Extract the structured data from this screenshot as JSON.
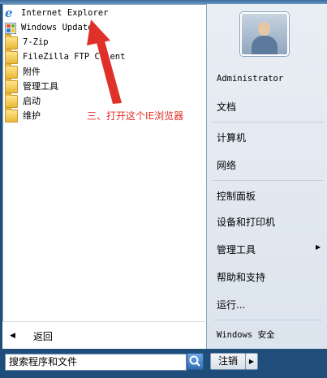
{
  "programs": [
    {
      "label": "Internet Explorer",
      "icon": "internet-explorer-icon",
      "mono": true
    },
    {
      "label": "Windows Update",
      "icon": "windows-update-icon",
      "mono": true
    },
    {
      "label": "7-Zip",
      "icon": "folder-icon",
      "mono": true
    },
    {
      "label": "FileZilla FTP Client",
      "icon": "folder-icon",
      "mono": true
    },
    {
      "label": "附件",
      "icon": "folder-icon",
      "mono": false
    },
    {
      "label": "管理工具",
      "icon": "folder-icon",
      "mono": false
    },
    {
      "label": "启动",
      "icon": "folder-icon",
      "mono": false
    },
    {
      "label": "维护",
      "icon": "folder-icon",
      "mono": false
    }
  ],
  "back_label": "返回",
  "annotation": "三、打开这个IE浏览器",
  "search": {
    "value": "搜索程序和文件"
  },
  "shutdown_label": "注销",
  "right_items": {
    "user": "Administrator",
    "documents": "文档",
    "computer": "计算机",
    "network": "网络",
    "control_panel": "控制面板",
    "devices_printers": "设备和打印机",
    "admin_tools": "管理工具",
    "help": "帮助和支持",
    "run": "运行...",
    "security": "Windows 安全"
  },
  "colors": {
    "annotation": "#e0302a",
    "taskbar": "#1f4e7a"
  }
}
